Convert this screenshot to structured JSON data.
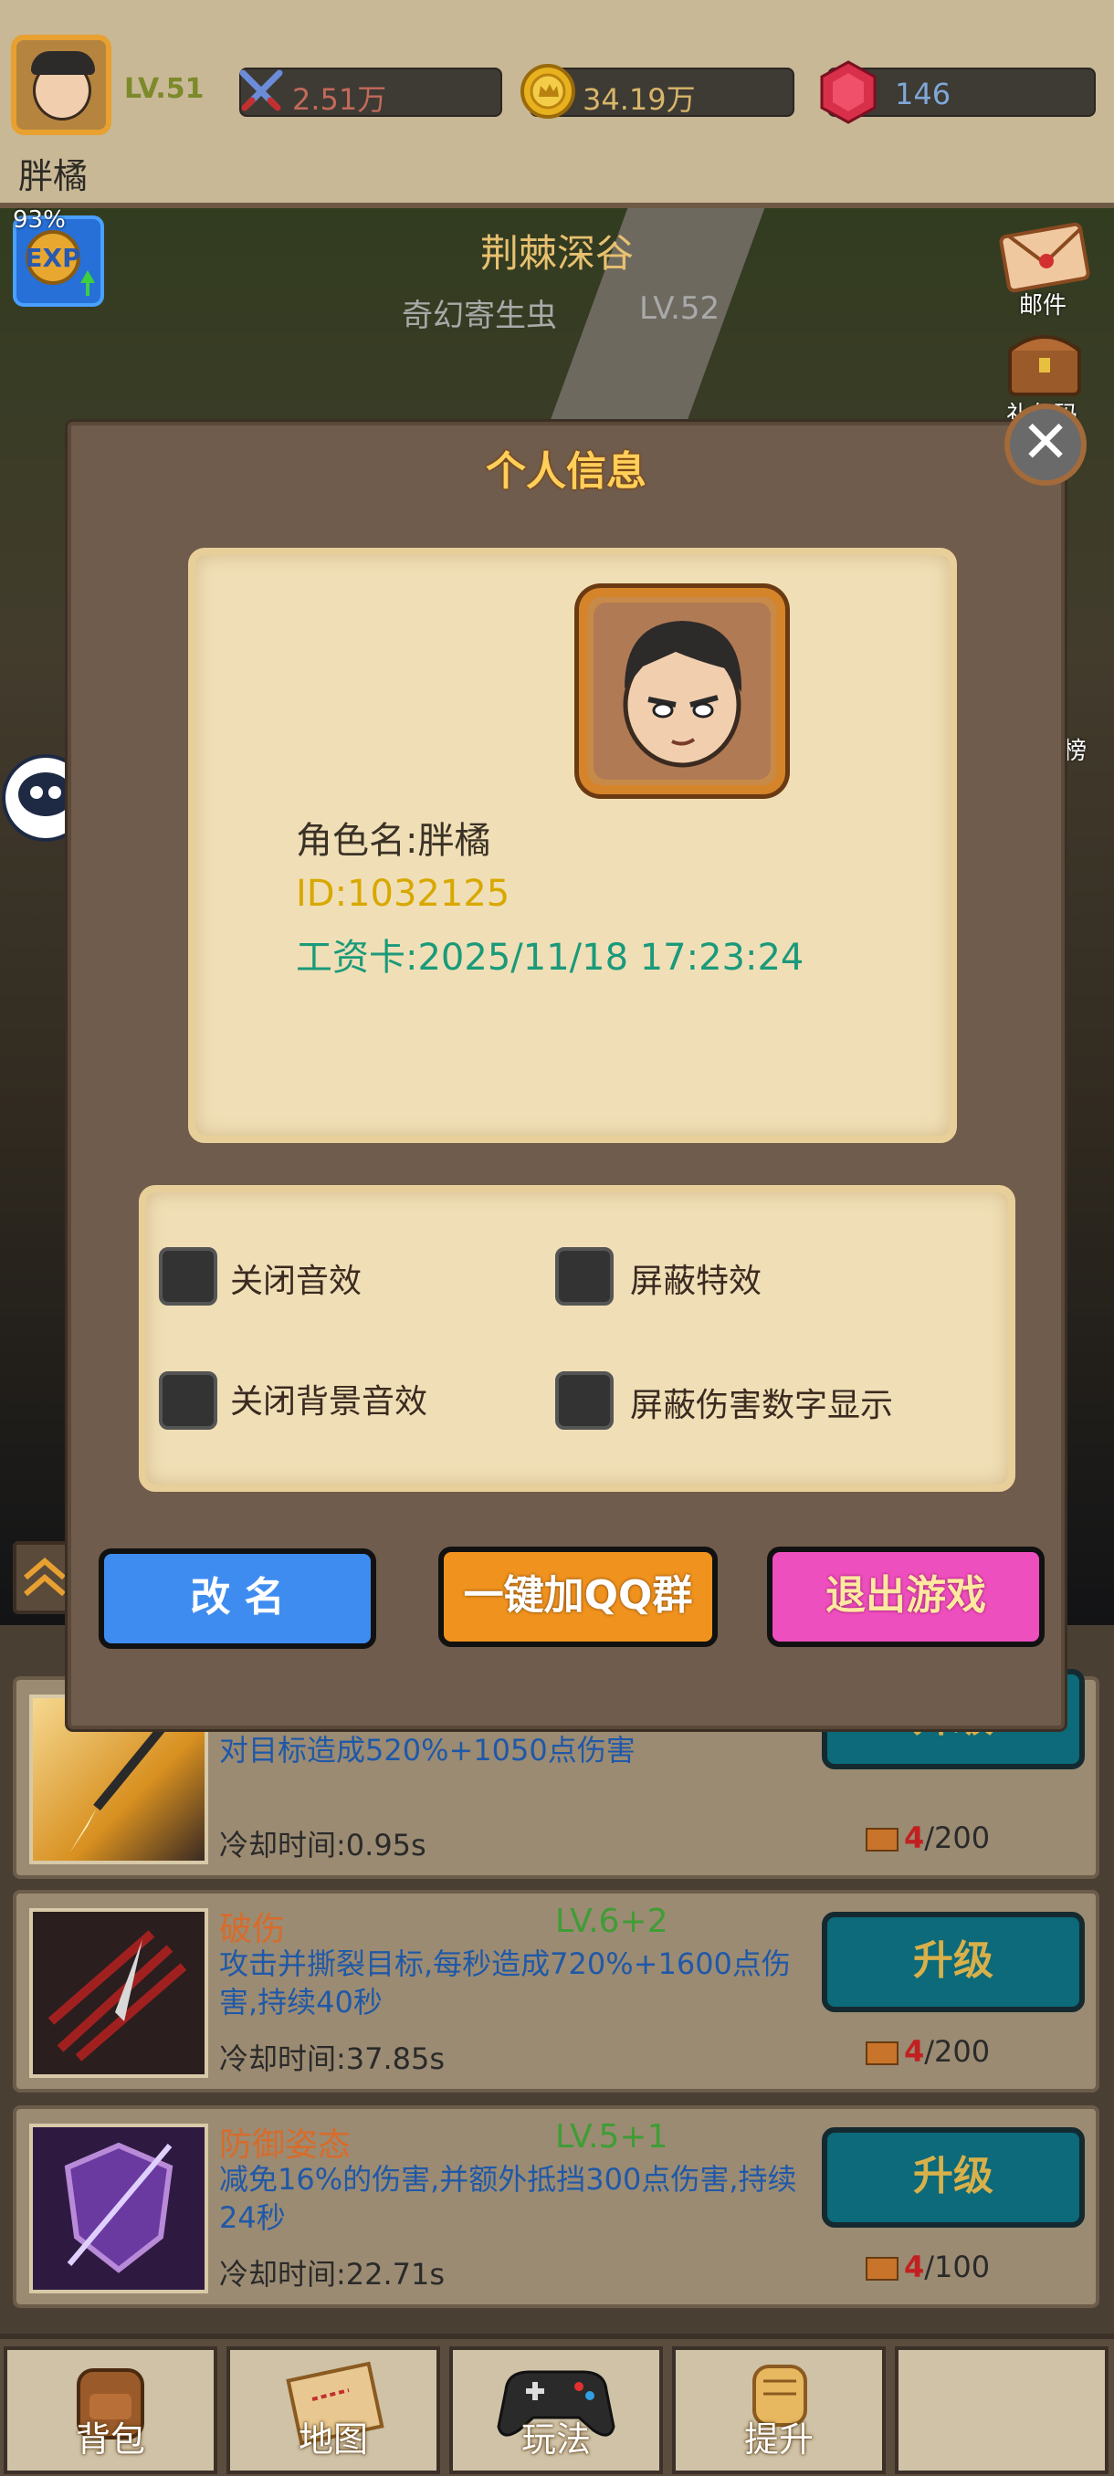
{
  "topbar": {
    "level": "LV.51",
    "player_name": "胖橘",
    "power": "2.51万",
    "gold": "34.19万",
    "gems": "146"
  },
  "scene": {
    "exp_percent": "93%",
    "stage_name": "荆棘深谷",
    "monster_name": "奇幻寄生虫",
    "monster_level": "LV.52",
    "side_mail": "邮件",
    "side_gift": "礼包码",
    "side_rank": "榜"
  },
  "dialog": {
    "title": "个人信息",
    "role_name": "角色名:胖橘",
    "player_id": "ID:1032125",
    "salary_card": "工资卡:2025/11/18 17:23:24",
    "settings": {
      "mute_sfx": "关闭音效",
      "hide_effects": "屏蔽特效",
      "mute_bgm": "关闭背景音效",
      "hide_damage_numbers": "屏蔽伤害数字显示"
    },
    "buttons": {
      "rename": "改 名",
      "join_qq": "一键加QQ群",
      "exit_game": "退出游戏"
    }
  },
  "skills": [
    {
      "name": "",
      "level": "",
      "desc": "对目标造成520%+1050点伤害",
      "cooldown": "冷却时间:0.95s",
      "upgrade": "升级",
      "cost_have": "4",
      "cost_need": "/200"
    },
    {
      "name": "破伤",
      "level": "LV.6+2",
      "desc": "攻击并撕裂目标,每秒造成720%+1600点伤害,持续40秒",
      "cooldown": "冷却时间:37.85s",
      "upgrade": "升级",
      "cost_have": "4",
      "cost_need": "/200"
    },
    {
      "name": "防御姿态",
      "level": "LV.5+1",
      "desc": "减免16%的伤害,并额外抵挡300点伤害,持续24秒",
      "cooldown": "冷却时间:22.71s",
      "upgrade": "升级",
      "cost_have": "4",
      "cost_need": "/100"
    }
  ],
  "bottom_nav": {
    "bag": "背包",
    "map": "地图",
    "play": "玩法",
    "upgrade": "提升"
  },
  "colors": {
    "rename_button": "#3f8cf0",
    "qq_button": "#f0921e",
    "exit_button": "#ee4fbe",
    "upgrade_button": "#0c6a7a"
  }
}
